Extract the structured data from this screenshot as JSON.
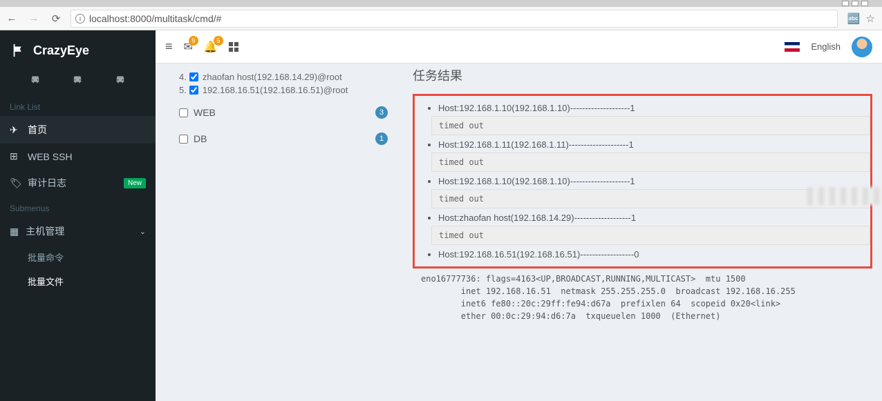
{
  "browser": {
    "url": "localhost:8000/multitask/cmd/#"
  },
  "brand": "CrazyEye",
  "sections": {
    "linklist": "Link List",
    "submenus": "Submenus"
  },
  "nav": {
    "home": "首页",
    "webssh": "WEB SSH",
    "audit": "审计日志",
    "newbadge": "New",
    "hostmgmt": "主机管理",
    "batchcmd": "批量命令",
    "batchfile": "批量文件"
  },
  "topbar": {
    "notif1": "9",
    "notif2": "5",
    "lang": "English"
  },
  "hosts": {
    "line4_num": "4.",
    "line4": "zhaofan host(192.168.14.29)@root",
    "line5_num": "5.",
    "line5": "192.168.16.51(192.168.16.51)@root",
    "group_web": "WEB",
    "group_web_count": "3",
    "group_db": "DB",
    "group_db_count": "1"
  },
  "results": {
    "title": "任务结果",
    "items": [
      {
        "hdr": "Host:192.168.1.10(192.168.1.10)--------------------1",
        "out": "timed out"
      },
      {
        "hdr": "Host:192.168.1.11(192.168.1.11)--------------------1",
        "out": "timed out"
      },
      {
        "hdr": "Host:192.168.1.10(192.168.1.10)--------------------1",
        "out": "timed out",
        "blur": true
      },
      {
        "hdr": "Host:zhaofan host(192.168.14.29)-------------------1",
        "out": "timed out"
      },
      {
        "hdr": "Host:192.168.16.51(192.168.16.51)------------------0",
        "out": ""
      }
    ],
    "netout": "eno16777736: flags=4163<UP,BROADCAST,RUNNING,MULTICAST>  mtu 1500\n        inet 192.168.16.51  netmask 255.255.255.0  broadcast 192.168.16.255\n        inet6 fe80::20c:29ff:fe94:d67a  prefixlen 64  scopeid 0x20<link>\n        ether 00:0c:29:94:d6:7a  txqueuelen 1000  (Ethernet)"
  }
}
